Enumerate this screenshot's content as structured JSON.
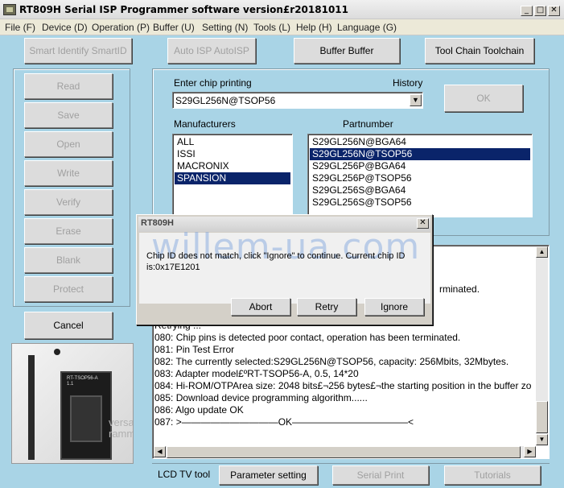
{
  "window": {
    "title": "RT809H Serial ISP Programmer software version£r20181011",
    "btn_minimize": "_",
    "btn_maximize": "□",
    "btn_close": "✕"
  },
  "menu": [
    "File (F)",
    "Device (D)",
    "Operation (P)",
    "Buffer (U)",
    "Setting (N)",
    "Tools (L)",
    "Help (H)",
    "Language (G)"
  ],
  "toolbar": {
    "smart_id": "Smart Identify SmartID",
    "auto_isp": "Auto ISP AutoISP",
    "buffer": "Buffer Buffer",
    "toolchain": "Tool Chain Toolchain"
  },
  "ops": [
    "Read",
    "Save",
    "Open",
    "Write",
    "Verify",
    "Erase",
    "Blank",
    "Protect"
  ],
  "cancel_label": "Cancel",
  "chip": {
    "enter_label": "Enter chip printing",
    "history_label": "History",
    "value": "S29GL256N@TSOP56",
    "ok_label": "OK",
    "manufacturers_label": "Manufacturers",
    "partnumber_label": "Partnumber",
    "manufacturers": [
      "ALL",
      "ISSI",
      "MACRONIX",
      "SPANSION"
    ],
    "manufacturer_selected_index": 3,
    "parts": [
      "S29GL256N@BGA64",
      "S29GL256N@TSOP56",
      "S29GL256P@BGA64",
      "S29GL256P@TSOP56",
      "S29GL256S@BGA64",
      "S29GL256S@TSOP56"
    ],
    "part_selected_index": 1
  },
  "log": {
    "partial_top": "rminated.",
    "lines": [
      "Retrying ...",
      "080:  Chip pins is detected poor contact, operation has been terminated.",
      "081:  Pin Test Error",
      "082:  The currently selected:S29GL256N@TSOP56, capacity: 256Mbits, 32Mbytes.",
      "083:  Adapter model£ºRT-TSOP56-A, 0.5, 14*20",
      "084:  Hi-ROM/OTPArea size: 2048 bits£¬256 bytes£¬the starting position in the buffer zo",
      "085:  Download device programming algorithm......",
      "086:  Algo update OK",
      "087:  >——————————OK————————————<"
    ]
  },
  "bottom_tabs": {
    "lcd": "LCD TV tool",
    "param": "Parameter setting",
    "serial": "Serial Print",
    "tutorials": "Tutorials"
  },
  "dialog": {
    "title": "RT809H",
    "close": "✕",
    "message_line1": "Chip ID does not match, click \"Ignore\" to continue. Current chip ID",
    "message_line2": "is:0x17E1201",
    "abort": "Abort",
    "retry": "Retry",
    "ignore": "Ignore"
  },
  "watermark": "willem-ua.com",
  "device_image": {
    "chip_label_1": "RT-TSOP56-A",
    "chip_label_2": "1.1",
    "brand_1": "versa",
    "brand_2": "ramm"
  },
  "colors": {
    "background": "#a9d4e6",
    "selection": "#0a246a",
    "button_face": "#dcdcdc"
  }
}
